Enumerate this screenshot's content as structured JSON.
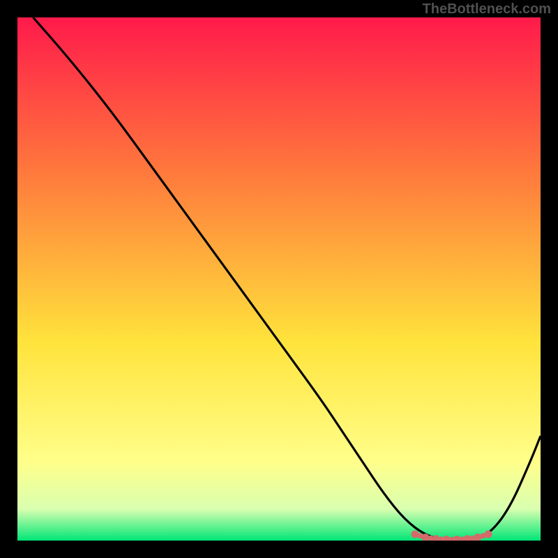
{
  "watermark": "TheBottleneck.com",
  "chart_data": {
    "type": "line",
    "title": "",
    "xlabel": "",
    "ylabel": "",
    "xlim": [
      0,
      100
    ],
    "ylim": [
      0,
      100
    ],
    "legend": false,
    "grid": false,
    "background_gradient": {
      "top_color": "#ff1a4b",
      "mid_colors": [
        "#ff7a3c",
        "#ffe33c",
        "#ffff8a",
        "#d9ffb0"
      ],
      "bottom_color": "#00e676"
    },
    "series": [
      {
        "name": "bottleneck-curve",
        "color": "#000000",
        "x": [
          3,
          10,
          18,
          26,
          34,
          42,
          50,
          58,
          62,
          66,
          70,
          74,
          78,
          82,
          86,
          90,
          94,
          98,
          100
        ],
        "y": [
          100,
          92,
          82,
          71,
          60,
          49,
          38,
          27,
          21,
          15,
          9,
          4,
          1,
          0,
          0,
          1,
          6,
          15,
          20
        ]
      },
      {
        "name": "sweet-spot-marker",
        "color": "#d46a6a",
        "style": "dotted-thick",
        "x": [
          76,
          78,
          80,
          82,
          84,
          86,
          88,
          90
        ],
        "y": [
          1.2,
          0.6,
          0.3,
          0.2,
          0.2,
          0.3,
          0.6,
          1.2
        ]
      }
    ],
    "annotations": []
  }
}
